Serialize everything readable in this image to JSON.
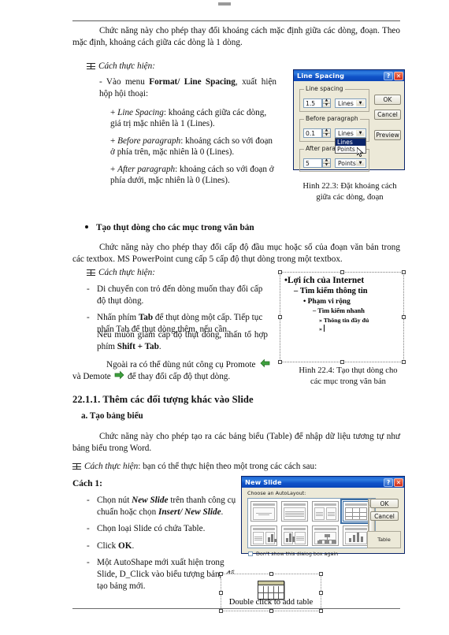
{
  "page": {
    "intro_paragraph": "Chức năng này cho phép thay đổi khoảng cách mặc định giữa các dòng, đoạn. Theo mặc định, khoảng cách giữa các dòng là 1 dòng.",
    "howto_label_1": "Cách thực hiện:",
    "menu_step_pre": "- Vào menu ",
    "menu_step_bold": "Format/ Line Spacing",
    "menu_step_post": ", xuất hiện hộp hội thoại:",
    "plus_items": [
      {
        "term": "Line Spacing",
        "text": ": khoảng cách giữa các dòng, giá trị mặc nhiên là 1 (Lines)."
      },
      {
        "term": "Before paragraph",
        "text": ": khoảng cách so với đoạn ở phía trên, mặc nhiên là 0 (Lines)."
      },
      {
        "term": "After paragraph",
        "text": ": khoảng cách so với đoạn ở phía dưới, mặc nhiên là 0 (Lines)."
      }
    ],
    "fig223_caption_line1": "Hình 22.3: Đặt khoảng cách",
    "fig223_caption_line2": "giữa các dòng, đoạn",
    "bullet_heading": "Tạo thụt dòng cho các mục trong văn bản",
    "indent_paragraph": "Chức năng này cho phép thay đổi cấp độ đầu mục hoặc số của đoạn văn bản trong các textbox. MS PowerPoint cung cấp 5 cấp độ thụt dòng trong một textbox.",
    "howto_label_2": "Cách thực hiện:",
    "indent_steps": [
      {
        "pre": "Di chuyển con trỏ đến dòng muốn thay đổi cấp độ thụt dòng.",
        "bold": "",
        "post": ""
      },
      {
        "pre": "Nhấn phím ",
        "bold": "Tab",
        "post": " để thụt dòng một cấp. Tiếp tục nhấn Tab để thụt dòng thêm, nếu cần."
      }
    ],
    "indent_note_pre": "Nếu muốn giảm cấp độ thụt dòng, nhấn tổ hợp phím ",
    "indent_note_bold": "Shift + Tab",
    "indent_note_post": ".",
    "promote_pre": "Ngoài ra có thể dùng nút công cụ Promote",
    "promote_mid": "và Demote",
    "promote_post": "để thay đổi cấp độ thụt dòng.",
    "fig224_caption_line1": "Hình 22.4: Tạo thụt dòng cho",
    "fig224_caption_line2": "các mục trong văn bản",
    "section_heading": "22.1.1. Thêm các đối tượng khác vào Slide",
    "sub_heading": "a. Tạo bảng biểu",
    "table_paragraph": "Chức năng này cho phép tạo ra các bảng biểu (Table) để nhập dữ liệu tương tự như bảng biểu trong Word.",
    "howto_label_3": "Cách thực hiện",
    "howto_label_3_rest": ": bạn có thể thực hiện theo một trong các cách sau:",
    "way_1_label": "Cách 1:",
    "way_1_steps": [
      {
        "pre": "Chọn nút ",
        "bold": "New Slide",
        "mid": " trên thanh công cụ chuẩn hoặc chọn ",
        "bold2": "Insert/ New Slide",
        "post": "."
      },
      {
        "pre": "Chọn loại Slide có chứa Table.",
        "bold": "",
        "mid": "",
        "bold2": "",
        "post": ""
      },
      {
        "pre": "Click ",
        "bold": "OK",
        "mid": "",
        "bold2": "",
        "post": "."
      },
      {
        "pre": "Một AutoShape mới xuất hiện trong Slide, D_Click vào biểu tượng bảng để tạo bảng mới.",
        "bold": "",
        "mid": "",
        "bold2": "",
        "post": ""
      }
    ]
  },
  "line_spacing_dialog": {
    "title": "Line Spacing",
    "help_btn": "?",
    "close_btn": "✕",
    "group_1_label": "Line spacing",
    "group_1_value": "1.5",
    "group_1_unit": "Lines",
    "group_2_label": "Before paragraph",
    "group_2_value": "0.1",
    "group_2_unit": "Lines",
    "group_3_label": "After paragraph",
    "group_3_value": "5",
    "group_3_unit": "Points",
    "dropdown_options": [
      "Lines",
      "Points"
    ],
    "dropdown_selected": "Lines",
    "btn_ok": "OK",
    "btn_cancel": "Cancel",
    "btn_preview": "Preview"
  },
  "slide_preview": {
    "level1": "Lợi ích của Internet",
    "level2": "Tìm kiếm thông tin",
    "level3": "Phạm vi rộng",
    "level4": "Tìm kiếm nhanh",
    "level5": "Thông tin đầy đủ",
    "level6": "",
    "bullet_l1": "•",
    "bullet_l2": "–",
    "bullet_l3": "•",
    "bullet_l4": "–",
    "bullet_l5": "»",
    "bullet_l6": "»"
  },
  "new_slide_dialog": {
    "title": "New Slide",
    "help_btn": "?",
    "close_btn": "✕",
    "autolayout_label": "Choose an AutoLayout:",
    "btn_ok": "OK",
    "btn_cancel": "Cancel",
    "preview_label": "Table",
    "checkbox_label": "Don't show this dialog box again",
    "scroll_up": "▲",
    "scroll_down": "▼",
    "layouts": [
      {
        "name": "title-only",
        "type": "title"
      },
      {
        "name": "title-text",
        "type": "text"
      },
      {
        "name": "two-column-text",
        "type": "two-text"
      },
      {
        "name": "table",
        "type": "table",
        "selected": true
      },
      {
        "name": "text-chart",
        "type": "text-chart"
      },
      {
        "name": "chart-text",
        "type": "chart-text"
      },
      {
        "name": "org-chart",
        "type": "org"
      },
      {
        "name": "chart",
        "type": "chart"
      },
      {
        "name": "text-clipart",
        "type": "text-clip"
      },
      {
        "name": "clipart-text",
        "type": "clip-text"
      },
      {
        "name": "title-only-2",
        "type": "title"
      },
      {
        "name": "blank",
        "type": "blank"
      }
    ]
  },
  "table_placeholder": {
    "caption": "Double click to add table"
  },
  "colors": {
    "titlebar_blue": "#0b46b8",
    "dialog_face": "#ece9d8",
    "selection_blue": "#0a246a",
    "promote_green": "#3fa13f",
    "text": "#101010"
  }
}
